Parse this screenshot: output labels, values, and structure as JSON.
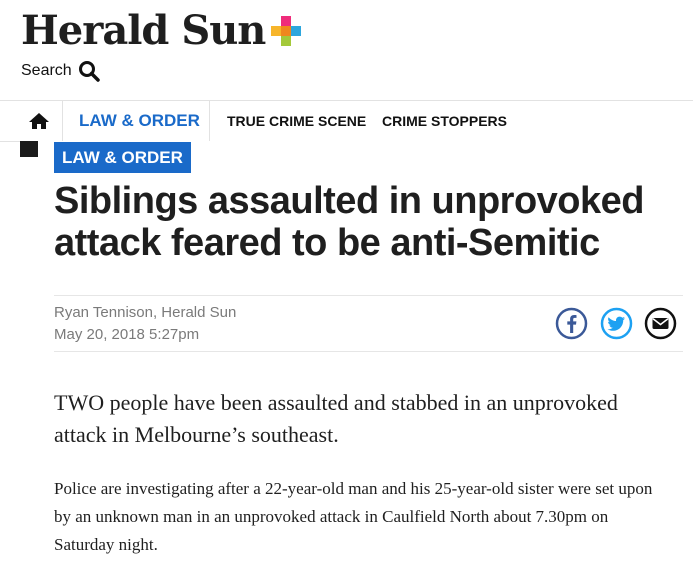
{
  "masthead": {
    "logo_text": "Herald Sun",
    "search_label": "Search",
    "icons": {
      "logo": "plus-logo-icon",
      "search": "search-icon"
    },
    "logo_colors": [
      "#ef2c7b",
      "#f7b52b",
      "#f0871e",
      "#2da6dd",
      "#a4c93a"
    ]
  },
  "nav": {
    "home_icon": "home-icon",
    "items": [
      {
        "label": "LAW & ORDER",
        "active": true
      },
      {
        "label": "TRUE CRIME SCENE",
        "active": false
      },
      {
        "label": "CRIME STOPPERS",
        "active": false
      }
    ]
  },
  "article": {
    "section_tag": "LAW & ORDER",
    "headline": "Siblings assaulted in unprovoked attack feared to be anti-Semitic",
    "byline": "Ryan Tennison, Herald Sun",
    "date": "May 20, 2018 5:27pm",
    "share": {
      "icons": [
        "facebook-icon",
        "twitter-icon",
        "email-icon"
      ],
      "colors": {
        "facebook": "#3b5998",
        "twitter": "#1da1f2",
        "email": "#111111"
      }
    },
    "lead": "TWO people have been assaulted and stabbed in an unprovoked attack in Melbourne’s southeast.",
    "paragraphs": [
      "Police are investigating after a 22-year-old man and his 25-year-old sister were set upon by an unknown man in an unprovoked attack in Caulfield North about 7.30pm on Saturday night."
    ]
  },
  "colors": {
    "accent": "#1a6ac9",
    "text": "#1f1f1f",
    "meta": "#7a7a7a"
  }
}
